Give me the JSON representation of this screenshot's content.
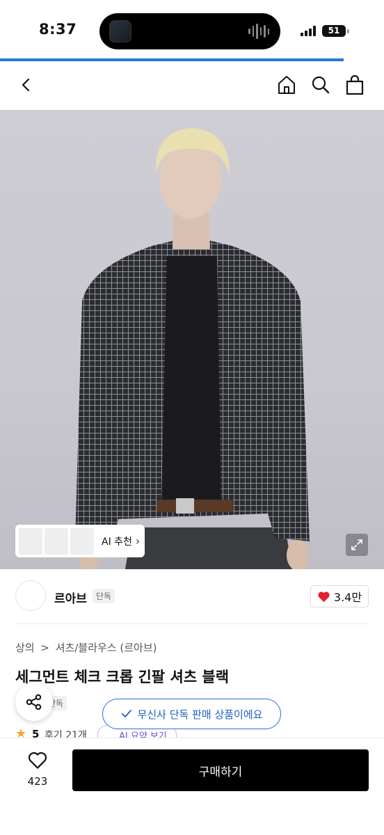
{
  "status_bar": {
    "time": "8:37",
    "battery": "51",
    "icons": [
      "signal-icon",
      "wifi-icon",
      "battery-icon"
    ]
  },
  "nav": {
    "icons": [
      "back-icon",
      "home-icon",
      "search-icon",
      "shopping-bag-icon"
    ]
  },
  "image": {
    "ai_recommend_label": "AI 추천",
    "icons": [
      "chevron-right-icon",
      "expand-icon"
    ]
  },
  "brand": {
    "name": "르아브",
    "badge": "단독",
    "likes": "3.4만",
    "icons": [
      "heart-icon"
    ]
  },
  "breadcrumb": {
    "items": [
      "상의",
      "셔츠/블라우스 (르아브)"
    ],
    "separator": ">"
  },
  "product": {
    "title": "세그먼트 체크 크롭 긴팔 셔츠 블랙",
    "exclusive_tag": "단독",
    "rating_score": "5",
    "review_text": "후기 21개",
    "ai_summary_label": "AI 요약 보기"
  },
  "toast": {
    "text": "무신사 단독 판매 상품이에요",
    "icon": "check-icon"
  },
  "bottom": {
    "wishlist_count": "423",
    "buy_label": "구매하기"
  },
  "colors": {
    "accent_blue": "#1f7ae0",
    "toast_blue": "#2a6fd6",
    "heart_red": "#e5202e",
    "star": "#f5a623",
    "buy_button": "#000000"
  }
}
